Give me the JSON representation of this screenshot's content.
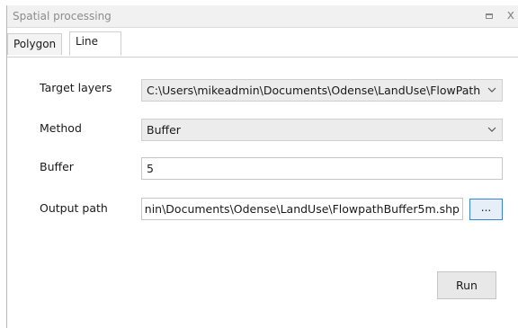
{
  "window": {
    "title": "Spatial processing",
    "restore_icon": "restore-icon",
    "close_glyph": "x"
  },
  "tabs": [
    {
      "label": "Polygon",
      "active": false
    },
    {
      "label": "Line",
      "active": true
    }
  ],
  "form": {
    "target_layers": {
      "label": "Target layers",
      "value": "C:\\Users\\mikeadmin\\Documents\\Odense\\LandUse\\FlowPath"
    },
    "method": {
      "label": "Method",
      "value": "Buffer"
    },
    "buffer": {
      "label": "Buffer",
      "value": "5"
    },
    "output_path": {
      "label": "Output path",
      "value": "nin\\Documents\\Odense\\LandUse\\FlowpathBuffer5m.shp"
    }
  },
  "buttons": {
    "browse_label": "...",
    "run_label": "Run"
  },
  "icons": {
    "dropdown": "chevron-down-icon"
  }
}
